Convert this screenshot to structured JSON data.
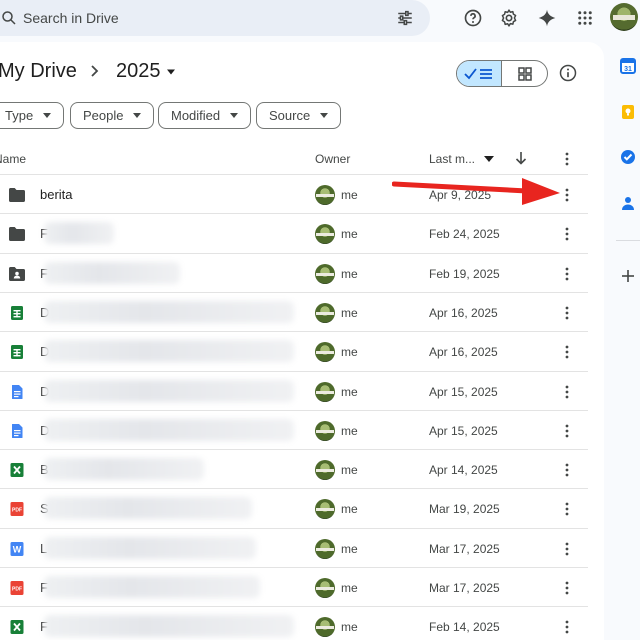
{
  "search": {
    "placeholder": "Search in Drive"
  },
  "breadcrumb": {
    "root": "My Drive",
    "current": "2025"
  },
  "filters": [
    {
      "label": "Type"
    },
    {
      "label": "People"
    },
    {
      "label": "Modified"
    },
    {
      "label": "Source"
    }
  ],
  "columns": {
    "name": "Name",
    "owner": "Owner",
    "last_modified": "Last m..."
  },
  "rows": [
    {
      "icon": "folder-icon",
      "name": "berita",
      "owner": "me",
      "date": "Apr 9, 2025"
    },
    {
      "icon": "folder-icon",
      "name": "F",
      "owner": "me",
      "date": "Feb 24, 2025"
    },
    {
      "icon": "shared-folder-icon",
      "name": "F",
      "owner": "me",
      "date": "Feb 19, 2025"
    },
    {
      "icon": "sheets-icon",
      "name": "D",
      "owner": "me",
      "date": "Apr 16, 2025"
    },
    {
      "icon": "sheets-icon",
      "name": "D",
      "owner": "me",
      "date": "Apr 16, 2025"
    },
    {
      "icon": "docs-icon",
      "name": "D",
      "owner": "me",
      "date": "Apr 15, 2025"
    },
    {
      "icon": "docs-icon",
      "name": "D",
      "owner": "me",
      "date": "Apr 15, 2025"
    },
    {
      "icon": "excel-icon",
      "name": "B",
      "owner": "me",
      "date": "Apr 14, 2025"
    },
    {
      "icon": "pdf-icon",
      "name": "S",
      "owner": "me",
      "date": "Mar 19, 2025"
    },
    {
      "icon": "word-icon",
      "name": "L",
      "owner": "me",
      "date": "Mar 17, 2025"
    },
    {
      "icon": "pdf-icon",
      "name": "F",
      "owner": "me",
      "date": "Mar 17, 2025"
    },
    {
      "icon": "excel-icon",
      "name": "F",
      "owner": "me",
      "date": "Feb 14, 2025"
    }
  ],
  "colors": {
    "accent": "#0b57d0",
    "toggle_selected": "#c2e7ff",
    "arrow": "#e8251f"
  }
}
